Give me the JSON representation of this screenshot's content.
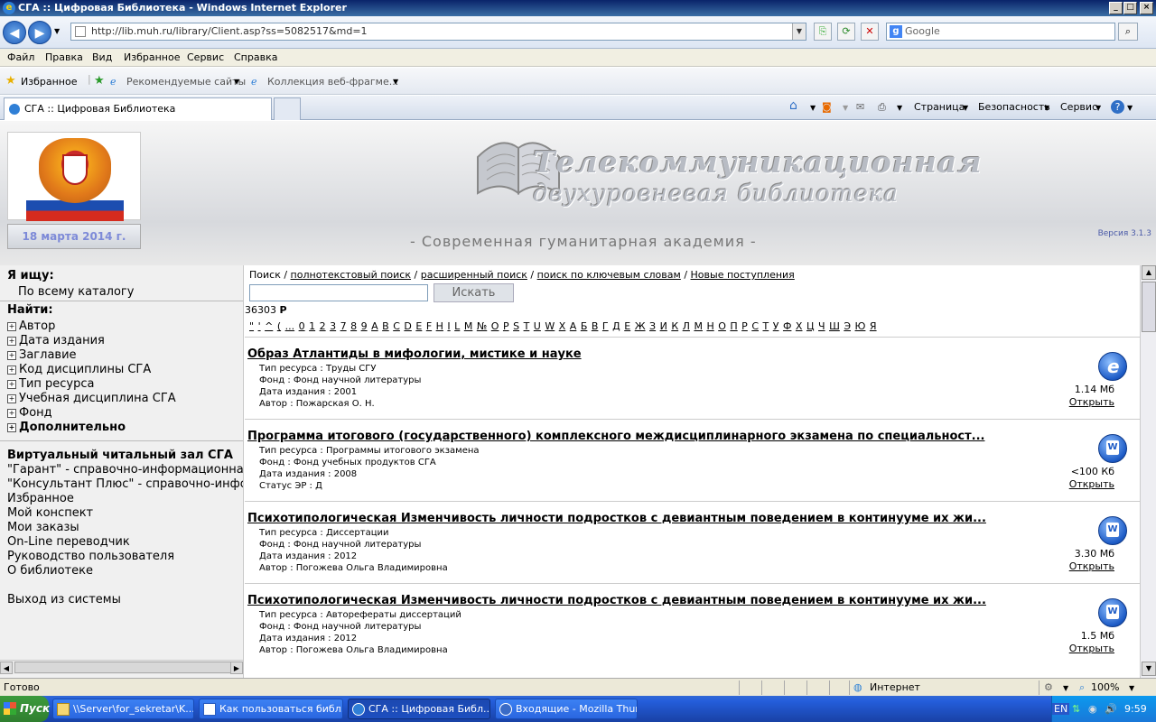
{
  "window": {
    "title": "СГА :: Цифровая Библиотека - Windows Internet Explorer"
  },
  "address": {
    "url": "http://lib.muh.ru/library/Client.asp?ss=5082517&md=1",
    "search_placeholder": "Google"
  },
  "menu": [
    "Файл",
    "Правка",
    "Вид",
    "Избранное",
    "Сервис",
    "Справка"
  ],
  "favorites": {
    "label": "Избранное",
    "items": [
      "Рекомендуемые сайты",
      "Коллекция веб-фрагме..."
    ]
  },
  "tab": {
    "title": "СГА :: Цифровая Библиотека"
  },
  "tabtools": {
    "page": "Страница",
    "security": "Безопасность",
    "service": "Сервис"
  },
  "header": {
    "date": "18 марта 2014 г.",
    "banner_line1": "Телекоммуникационная",
    "banner_line2": "двухуровневая библиотека",
    "academy": "- Современная гуманитарная академия -",
    "version": "Версия  3.1.3"
  },
  "sidebar": {
    "i_search_label": "Я ищу:",
    "i_search_value": "По всему каталогу",
    "find_label": "Найти:",
    "filters": [
      "Автор",
      "Дата издания",
      "Заглавие",
      "Код дисциплины СГА",
      "Тип ресурса",
      "Учебная дисциплина СГА",
      "Фонд"
    ],
    "additional": "Дополнительно",
    "reading_room": "Виртуальный читальный зал СГА",
    "links": [
      "\"Гарант\" - справочно-информационная с",
      "\"Консультант Плюс\" - справочно-инфор",
      "Избранное",
      "Мой конспект",
      "Мои заказы",
      "On-Line переводчик",
      "Руководство пользователя",
      "О библиотеке"
    ],
    "logout": "Выход из системы"
  },
  "search": {
    "links": [
      "Поиск",
      "полнотекстовый поиск",
      "расширенный поиск",
      "поиск по ключевым словам",
      "Новые поступления"
    ],
    "button": "Искать",
    "count": "36303",
    "count_letter": "Р",
    "alphabet": [
      "\"",
      "'",
      "^",
      "(",
      "...",
      "0",
      "1",
      "2",
      "3",
      "7",
      "8",
      "9",
      "A",
      "B",
      "C",
      "D",
      "E",
      "F",
      "H",
      "I",
      "L",
      "M",
      "№",
      "O",
      "P",
      "S",
      "T",
      "U",
      "W",
      "X",
      "А",
      "Б",
      "В",
      "Г",
      "Д",
      "Е",
      "Ж",
      "З",
      "И",
      "К",
      "Л",
      "М",
      "Н",
      "О",
      "П",
      "Р",
      "С",
      "Т",
      "У",
      "Ф",
      "Х",
      "Ц",
      "Ч",
      "Ш",
      "Э",
      "Ю",
      "Я"
    ]
  },
  "results": [
    {
      "title": "Образ Атлантиды в мифологии, мистике и науке",
      "fields": [
        "Тип ресурса  :  Труды СГУ",
        "Фонд  :  Фонд научной литературы",
        "Дата издания  :  2001",
        "Автор  :  Пожарская О. Н."
      ],
      "icon": "ie-icon",
      "size": "1.14 Мб",
      "open": "Открыть"
    },
    {
      "title": "Программа итогового (государственного) комплексного междисциплинарного экзамена по специальност...",
      "fields": [
        "Тип ресурса  :  Программы итогового экзамена",
        "Фонд  :  Фонд учебных продуктов СГА",
        "Дата издания  :  2008",
        "Статус ЭР   :  Д"
      ],
      "icon": "word-icon",
      "size": "<100 Кб",
      "open": "Открыть"
    },
    {
      "title": "Психотипологическая Изменчивость личности подростков с девиантным поведением в континууме их жи...",
      "fields": [
        "Тип ресурса  :  Диссертации",
        "Фонд  :  Фонд научной литературы",
        "Дата издания  :  2012",
        "Автор  :  Погожева Ольга Владимировна"
      ],
      "icon": "word-icon",
      "size": "3.30 Мб",
      "open": "Открыть"
    },
    {
      "title": "Психотипологическая Изменчивость личности подростков с девиантным поведением в континууме их жи...",
      "fields": [
        "Тип ресурса  :  Авторефераты диссертаций",
        "Фонд  :  Фонд научной литературы",
        "Дата издания  :  2012",
        "Автор  :  Погожева Ольга Владимировна"
      ],
      "icon": "word-icon",
      "size": "1.5 Мб",
      "open": "Открыть"
    }
  ],
  "status": {
    "text": "Готово",
    "zone": "Интернет",
    "zoom": "100%"
  },
  "taskbar": {
    "start": "Пуск",
    "tasks": [
      "\\\\Server\\for_sekretar\\K...",
      "Как пользоваться библ...",
      "СГА :: Цифровая Библ...",
      "Входящие - Mozilla Thun..."
    ],
    "lang": "EN",
    "clock": "9:59"
  }
}
